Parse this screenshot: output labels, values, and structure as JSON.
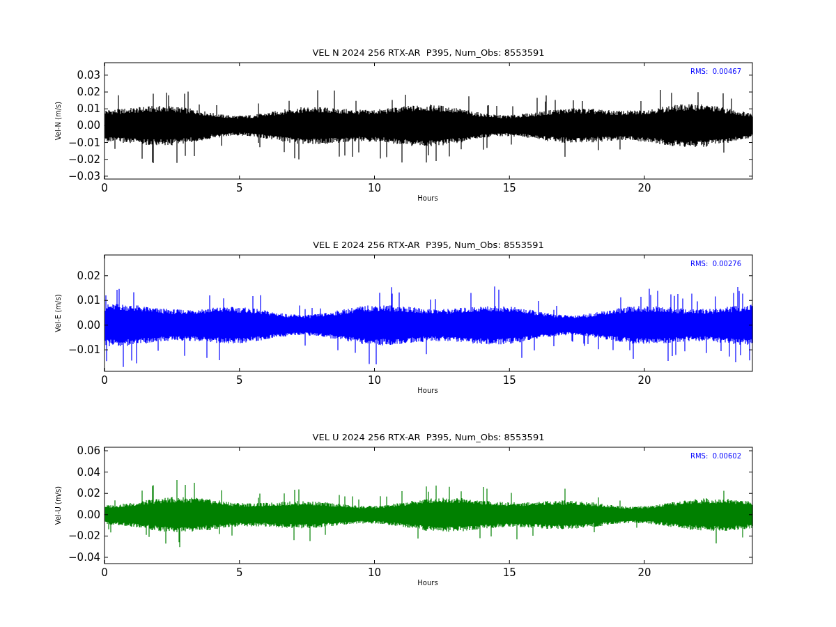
{
  "panels": [
    {
      "title": "VEL N 2024 256 RTX-AR  P395, Num_Obs: 8553591",
      "ylabel": "Vel-N (m/s)",
      "xlabel": "Hours",
      "rms": "RMS:  0.00467",
      "color": "#000000",
      "xticks": [
        "0",
        "5",
        "10",
        "15",
        "20"
      ],
      "yticks": [
        "0.03",
        "0.02",
        "0.01",
        "0.00",
        "−0.01",
        "−0.02",
        "−0.03"
      ]
    },
    {
      "title": "VEL E 2024 256 RTX-AR  P395, Num_Obs: 8553591",
      "ylabel": "Vel-E (m/s)",
      "xlabel": "Hours",
      "rms": "RMS:  0.00276",
      "color": "#0000ff",
      "xticks": [
        "0",
        "5",
        "10",
        "15",
        "20"
      ],
      "yticks": [
        "0.02",
        "0.01",
        "0.00",
        "−0.01"
      ]
    },
    {
      "title": "VEL U 2024 256 RTX-AR  P395, Num_Obs: 8553591",
      "ylabel": "Vel-U (m/s)",
      "xlabel": "Hours",
      "rms": "RMS:  0.00602",
      "color": "#008000",
      "xticks": [
        "0",
        "5",
        "10",
        "15",
        "20"
      ],
      "yticks": [
        "0.06",
        "0.04",
        "0.02",
        "0.00",
        "−0.02",
        "−0.04"
      ]
    }
  ]
}
